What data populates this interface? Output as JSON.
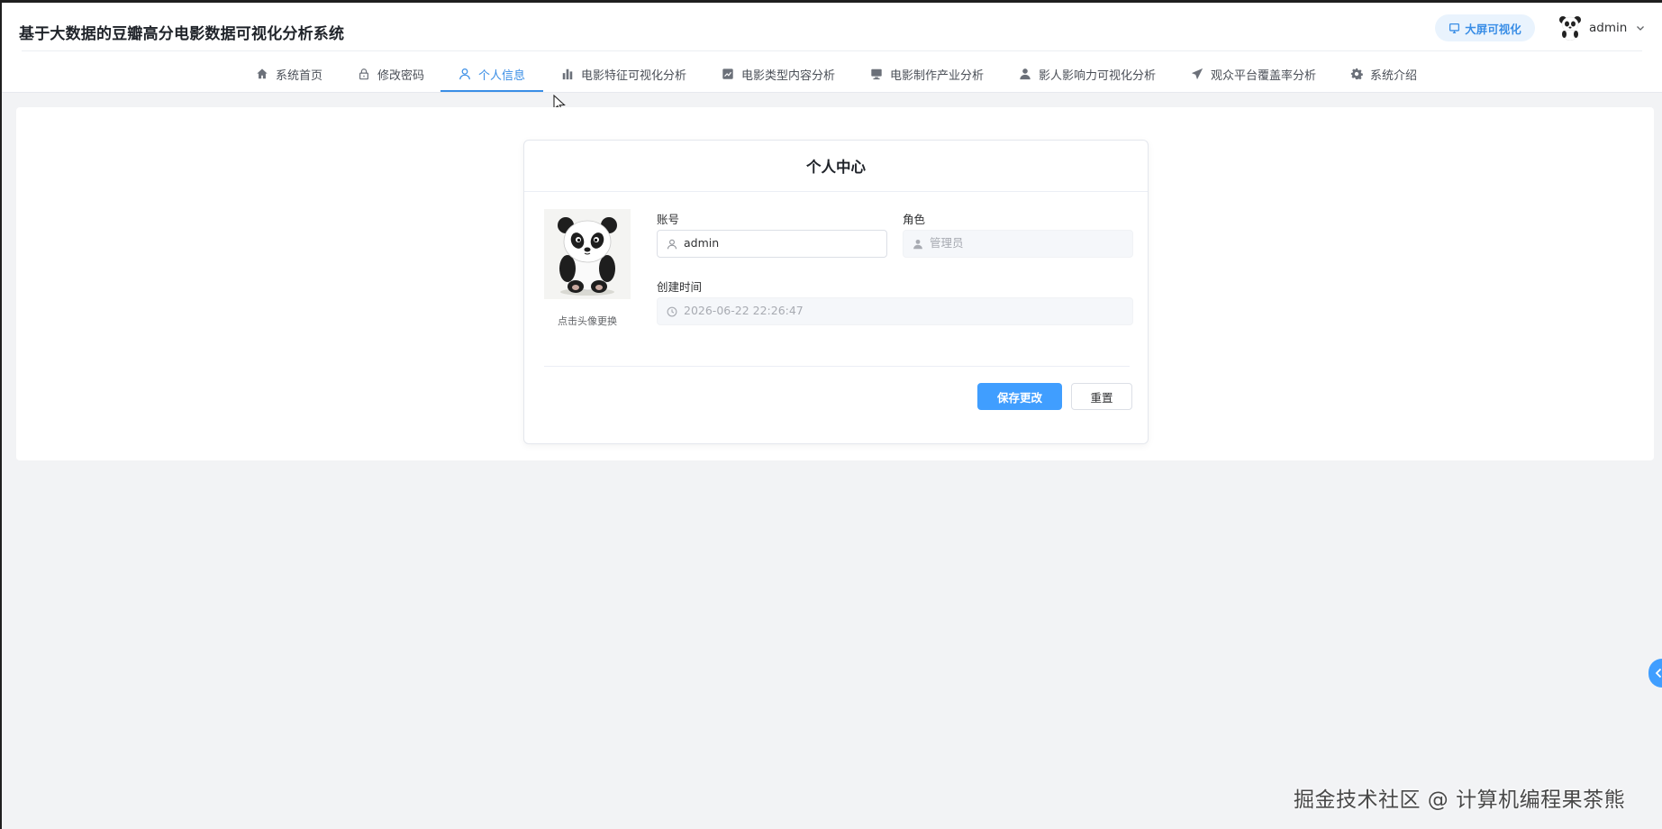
{
  "app": {
    "title": "基于大数据的豆瓣高分电影数据可视化分析系统",
    "bigscreen_label": "大屏可视化",
    "user_name": "admin"
  },
  "nav": {
    "items": [
      {
        "label": "系统首页",
        "icon": "home-icon"
      },
      {
        "label": "修改密码",
        "icon": "lock-icon"
      },
      {
        "label": "个人信息",
        "icon": "user-icon",
        "active": true
      },
      {
        "label": "电影特征可视化分析",
        "icon": "bar-chart-icon"
      },
      {
        "label": "电影类型内容分析",
        "icon": "line-chart-icon"
      },
      {
        "label": "电影制作产业分析",
        "icon": "monitor-icon"
      },
      {
        "label": "影人影响力可视化分析",
        "icon": "person-icon"
      },
      {
        "label": "观众平台覆盖率分析",
        "icon": "send-icon"
      },
      {
        "label": "系统介绍",
        "icon": "gear-icon"
      }
    ]
  },
  "profile": {
    "card_title": "个人中心",
    "avatar_caption": "点击头像更换",
    "account_label": "账号",
    "account_value": "admin",
    "role_label": "角色",
    "role_value": "管理员",
    "created_label": "创建时间",
    "created_value": "2026-06-22 22:26:47",
    "save_label": "保存更改",
    "reset_label": "重置"
  },
  "watermark": "掘金技术社区 @ 计算机编程果茶熊",
  "colors": {
    "accent": "#409eff",
    "active_nav": "#3a8ee6",
    "page_bg": "#f2f3f5"
  }
}
